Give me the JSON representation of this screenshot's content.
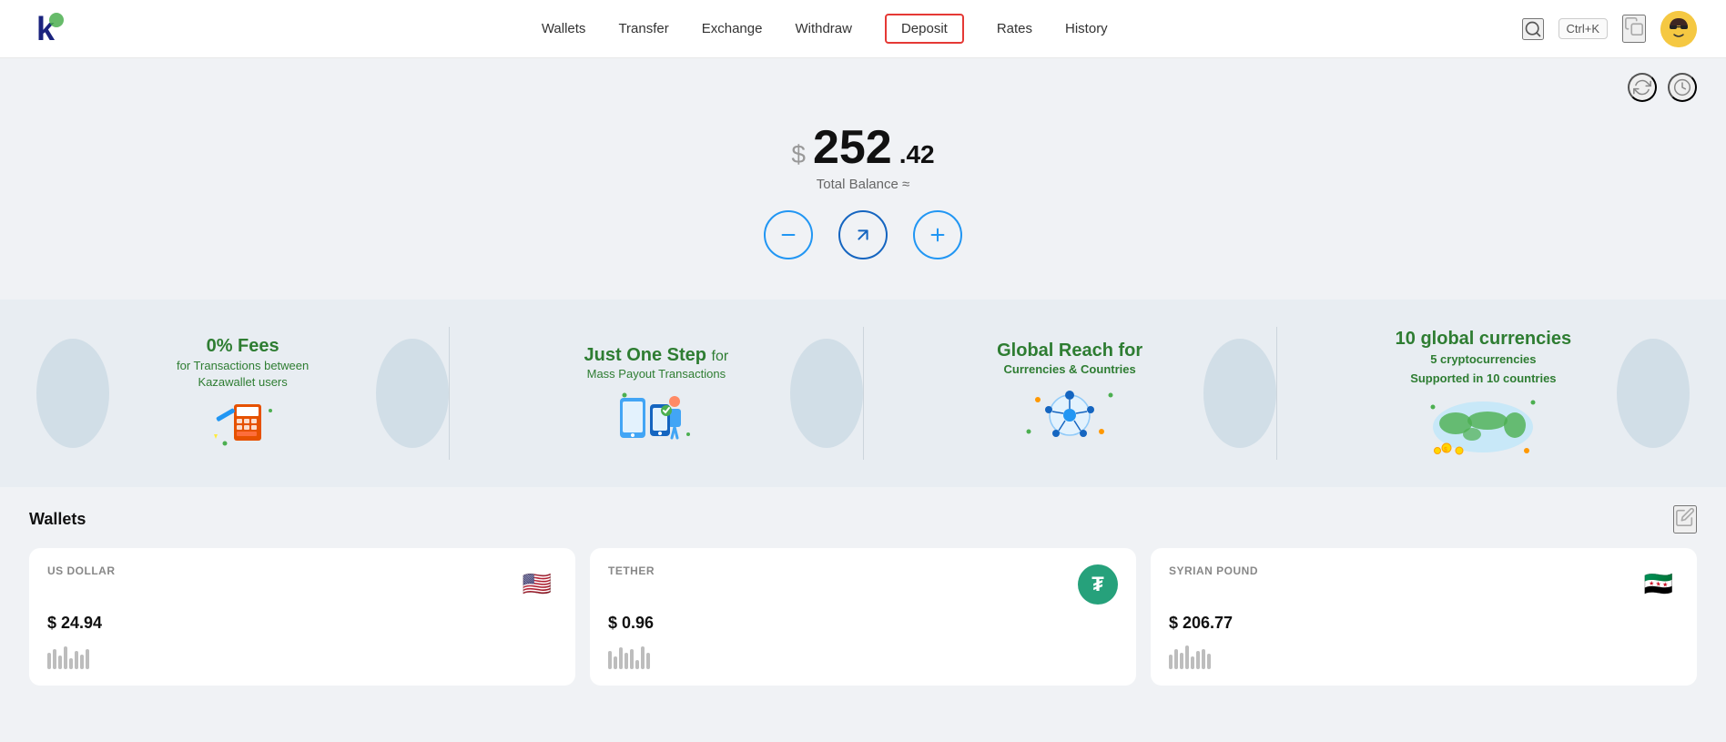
{
  "header": {
    "logo_alt": "KazaWallet Logo",
    "nav": {
      "wallets": "Wallets",
      "transfer": "Transfer",
      "exchange": "Exchange",
      "withdraw": "Withdraw",
      "deposit": "Deposit",
      "rates": "Rates",
      "history": "History"
    },
    "shortcut": "Ctrl+K",
    "search_label": "search"
  },
  "balance": {
    "dollar_sign": "$",
    "integer": "252",
    "decimal": ".42",
    "label": "Total Balance ≈"
  },
  "action_buttons": {
    "withdraw": "−",
    "send": "↗",
    "deposit": "+"
  },
  "banners": [
    {
      "title": "0% Fees",
      "subtitle": "for Transactions between\nKazawallet users",
      "img_type": "calculator"
    },
    {
      "title": "Just One Step for",
      "subtitle": "Mass Payout Transactions",
      "img_type": "mobile"
    },
    {
      "title": "Global Reach for",
      "subtitle": "Currencies & Countries",
      "img_type": "globe"
    },
    {
      "title": "10 global currencies",
      "subtitle": "5 cryptocurrencies\nSupported in 10 countries",
      "img_type": "world"
    }
  ],
  "wallets": {
    "title": "Wallets",
    "items": [
      {
        "name": "US DOLLAR",
        "amount": "$ 24.94",
        "flag": "🇺🇸",
        "flag_type": "us"
      },
      {
        "name": "TETHER",
        "amount": "$ 0.96",
        "flag": "₮",
        "flag_type": "tether"
      },
      {
        "name": "SYRIAN POUND",
        "amount": "$ 206.77",
        "flag": "🇸🇾",
        "flag_type": "syria"
      }
    ]
  }
}
